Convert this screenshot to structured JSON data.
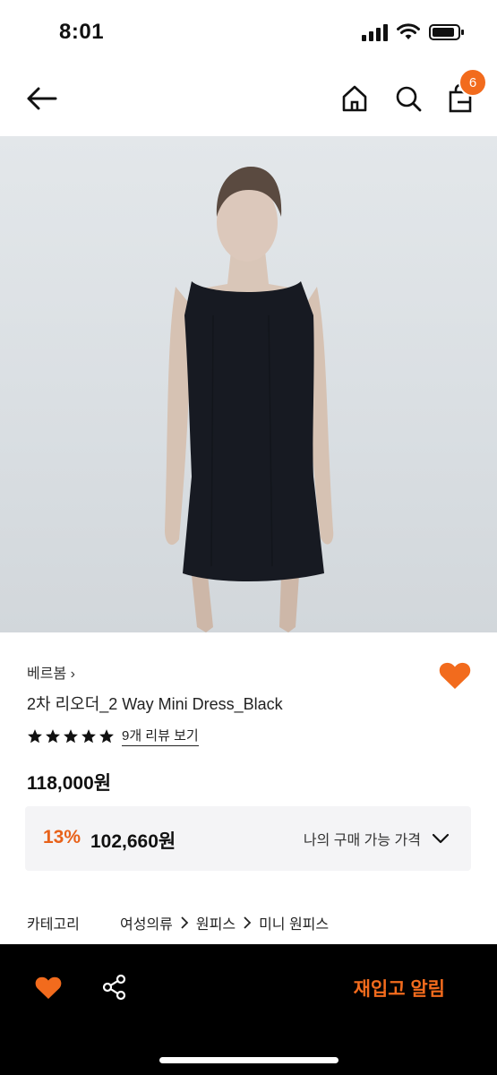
{
  "status_bar": {
    "time": "8:01"
  },
  "header": {
    "cart_count": "6"
  },
  "product": {
    "brand": "베르봄 ›",
    "name": "2차 리오더_2 Way Mini Dress_Black",
    "rating_stars": 5,
    "review_link": "9개 리뷰 보기",
    "price": "118,000원",
    "discount": {
      "percent": "13%",
      "price": "102,660원",
      "my_price_label": "나의 구매 가능 가격"
    },
    "category": {
      "label": "카테고리",
      "path": [
        "여성의류",
        "원피스",
        "미니 원피스"
      ]
    }
  },
  "bottom_bar": {
    "restock_label": "재입고 알림"
  },
  "colors": {
    "accent": "#f26b1d",
    "bar": "#000000"
  }
}
